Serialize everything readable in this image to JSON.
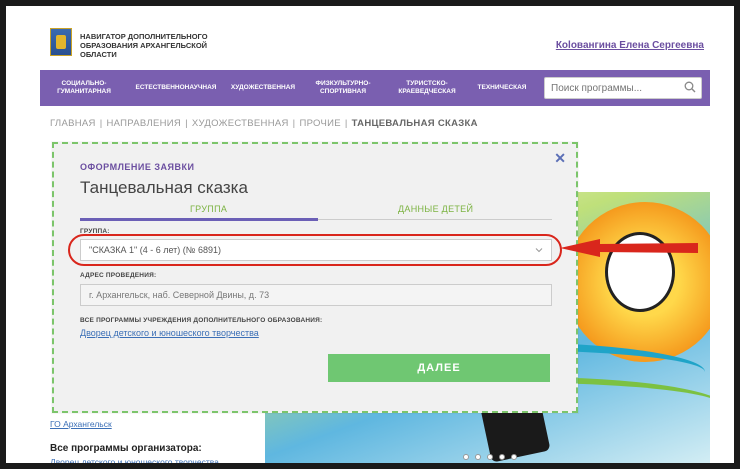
{
  "header": {
    "brand": "НАВИГАТОР ДОПОЛНИТЕЛЬНОГО ОБРАЗОВАНИЯ АРХАНГЕЛЬСКОЙ ОБЛАСТИ",
    "user_name": "Кolовангина Елена Сергеевна"
  },
  "nav": {
    "items": [
      "СОЦИАЛЬНО-ГУМАНИТАРНАЯ",
      "ЕСТЕСТВЕННОНАУЧНАЯ",
      "ХУДОЖЕСТВЕННАЯ",
      "ФИЗКУЛЬТУРНО-СПОРТИВНАЯ",
      "ТУРИСТСКО-КРАЕВЕДЧЕСКАЯ",
      "ТЕХНИЧЕСКАЯ"
    ],
    "search_placeholder": "Поиск программы..."
  },
  "breadcrumb": {
    "items": [
      "ГЛАВНАЯ",
      "НАПРАВЛЕНИЯ",
      "ХУДОЖЕСТВЕННАЯ",
      "ПРОЧИЕ"
    ],
    "current": "ТАНЦЕВАЛЬНАЯ СКАЗКА"
  },
  "modal": {
    "section_label": "ОФОРМЛЕНИЕ ЗАЯВКИ",
    "title": "Танцевальная сказка",
    "tabs": [
      "ГРУППА",
      "ДАННЫЕ ДЕТЕЙ"
    ],
    "group_label": "ГРУППА:",
    "group_value": "\"СКАЗКА 1\" (4 - 6 лет) (№ 6891)",
    "address_label": "АДРЕС ПРОВЕДЕНИЯ:",
    "address_value": "г. Архангельск, наб. Северной Двины, д. 73",
    "programs_label": "ВСЕ ПРОГРАММЫ УЧРЕЖДЕНИЯ ДОПОЛНИТЕЛЬНОГО ОБРАЗОВАНИЯ:",
    "programs_link": "Дворец детского и юношеского творчества",
    "next_button": "ДАЛЕЕ",
    "close": "✕"
  },
  "page": {
    "municipality_link": "ГО Архангельск",
    "organizer_heading": "Все программы организатора:",
    "organizer_link": "Дворец детского и юношеского творчества"
  },
  "colors": {
    "nav_bg": "#7a5fb0",
    "accent_purple": "#6b4ea0",
    "tab_green": "#7cb342",
    "button_green": "#6fc772",
    "highlight_red": "#d9261c",
    "link_blue": "#3b6fb6"
  }
}
